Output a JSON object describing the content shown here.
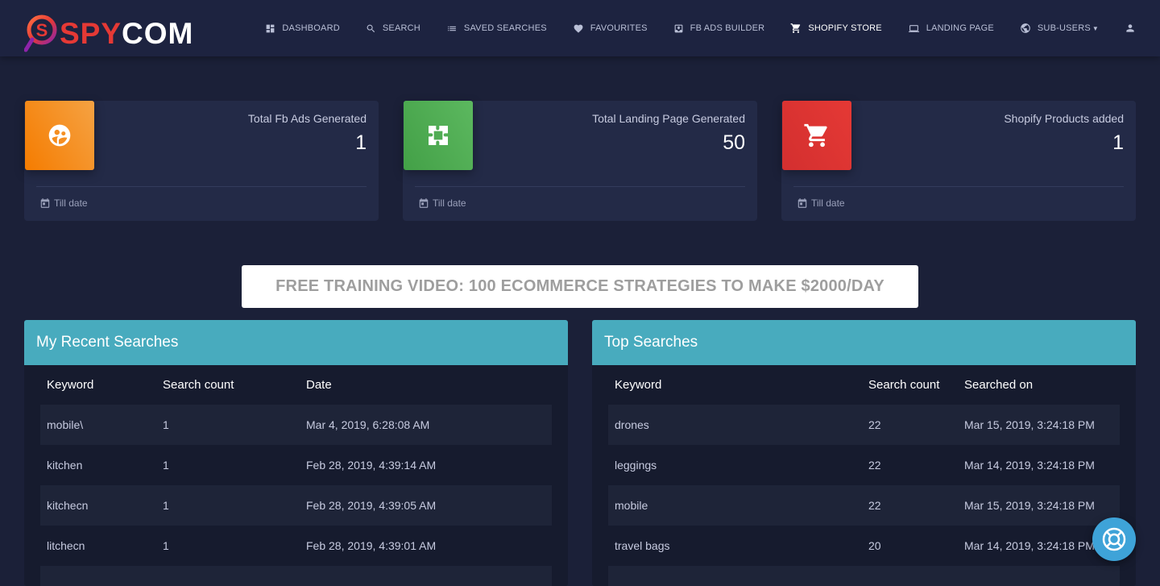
{
  "brand": {
    "part1": "SPY",
    "part2": "COM"
  },
  "nav": [
    {
      "label": "DASHBOARD",
      "icon": "dashboard-icon"
    },
    {
      "label": "SEARCH",
      "icon": "search-icon"
    },
    {
      "label": "SAVED SEARCHES",
      "icon": "list-icon"
    },
    {
      "label": "FAVOURITES",
      "icon": "heart-icon"
    },
    {
      "label": "FB ADS BUILDER",
      "icon": "inbox-icon"
    },
    {
      "label": "SHOPIFY STORE",
      "icon": "cart-icon"
    },
    {
      "label": "LANDING PAGE",
      "icon": "laptop-icon"
    },
    {
      "label": "SUB-USERS",
      "icon": "globe-icon"
    }
  ],
  "stats": [
    {
      "title": "Total Fb Ads Generated",
      "value": "1",
      "footer": "Till date",
      "icon": "group-icon",
      "color": "#f57c00"
    },
    {
      "title": "Total Landing Page Generated",
      "value": "50",
      "footer": "Till date",
      "icon": "puzzle-icon",
      "color": "#43a047"
    },
    {
      "title": "Shopify Products added",
      "value": "1",
      "footer": "Till date",
      "icon": "cart-icon",
      "color": "#e53935"
    }
  ],
  "promo": {
    "label": "FREE TRAINING VIDEO: 100 ECOMMERCE STRATEGIES TO MAKE $2000/DAY"
  },
  "recent": {
    "title": "My Recent Searches",
    "columns": [
      "Keyword",
      "Search count",
      "Date"
    ],
    "rows": [
      [
        "mobile\\",
        "1",
        "Mar 4, 2019, 6:28:08 AM"
      ],
      [
        "kitchen",
        "1",
        "Feb 28, 2019, 4:39:14 AM"
      ],
      [
        "kitchecn",
        "1",
        "Feb 28, 2019, 4:39:05 AM"
      ],
      [
        "litchecn",
        "1",
        "Feb 28, 2019, 4:39:01 AM"
      ]
    ]
  },
  "top": {
    "title": "Top Searches",
    "columns": [
      "Keyword",
      "Search count",
      "Searched on"
    ],
    "rows": [
      [
        "drones",
        "22",
        "Mar 15, 2019, 3:24:18 PM"
      ],
      [
        "leggings",
        "22",
        "Mar 14, 2019, 3:24:18 PM"
      ],
      [
        "mobile",
        "22",
        "Mar 15, 2019, 3:24:18 PM"
      ],
      [
        "travel bags",
        "20",
        "Mar 14, 2019, 3:24:18 PM"
      ]
    ]
  },
  "colors": {
    "accent_header": "#48abbe",
    "help_button": "#3ea3d8"
  }
}
